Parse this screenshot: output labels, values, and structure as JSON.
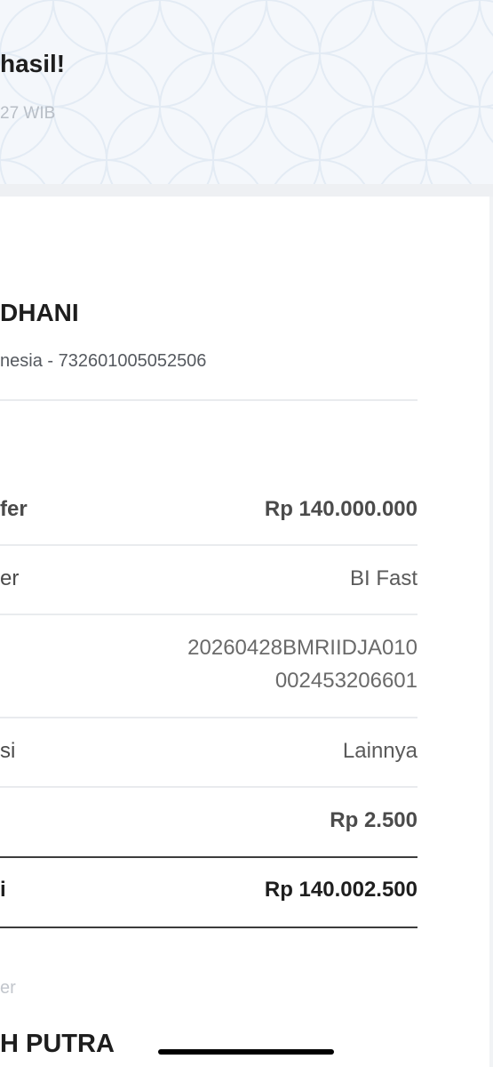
{
  "header": {
    "title": "hasil!",
    "time": "27 WIB"
  },
  "recipient": {
    "name": "DHANI",
    "bank_account": "nesia - 732601005052506"
  },
  "details": [
    {
      "label": "fer",
      "value": "Rp 140.000.000"
    },
    {
      "label": "er",
      "value": "BI Fast"
    },
    {
      "label": "",
      "value_line1": "20260428BMRIIDJA010",
      "value_line2": "002453206601"
    },
    {
      "label": "si",
      "value": "Lainnya"
    },
    {
      "label": "",
      "value": "Rp 2.500"
    },
    {
      "label": "i",
      "value": "Rp 140.002.500"
    }
  ],
  "sender": {
    "label": "er",
    "name": "H PUTRA"
  },
  "colors": {
    "header_bg": "#f4f7fb",
    "pattern": "#e3ebf4",
    "text_dark": "#1e1e1e",
    "divider": "#e9ebee"
  }
}
